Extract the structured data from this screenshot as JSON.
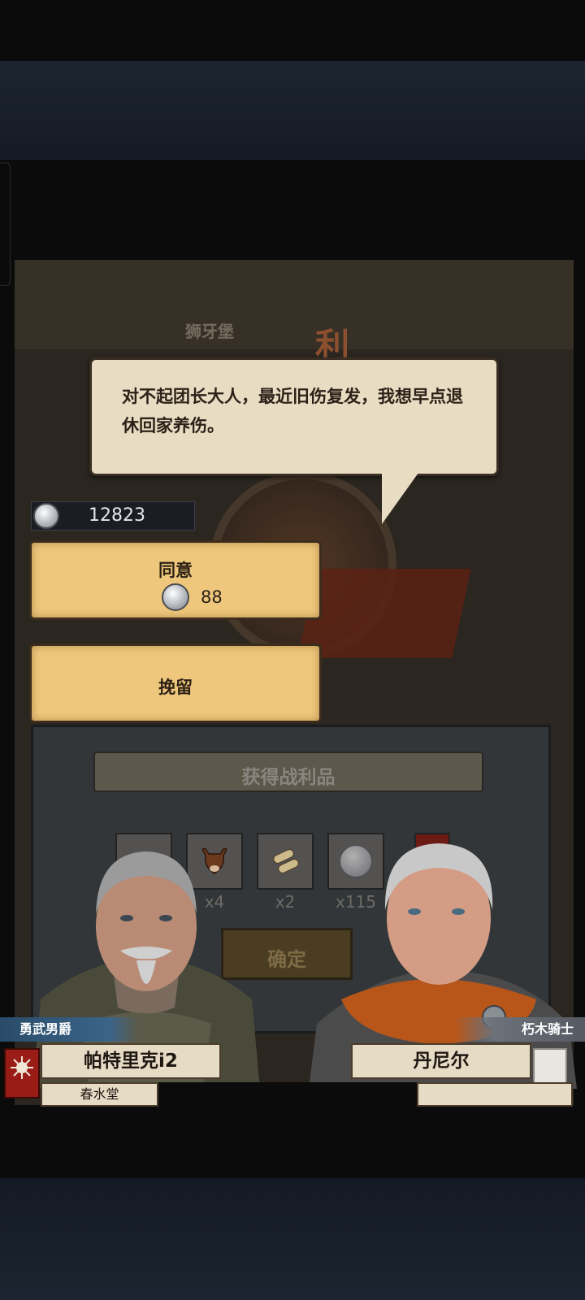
{
  "dialogue": {
    "text": "对不起团长大人，最近旧伤复发，我想早点退休回家养伤。"
  },
  "currency": {
    "silver_amount": "12823",
    "icon": "silver-coin-icon"
  },
  "choices": {
    "agree_label": "同意",
    "agree_cost": "88",
    "retain_label": "挽留"
  },
  "background": {
    "location_label": "狮牙堡",
    "banner_char": "利"
  },
  "loot": {
    "title": "获得战利品",
    "items": [
      {
        "icon": "cattle-icon",
        "qty": "x4"
      },
      {
        "icon": "scroll-icon",
        "qty": "x2"
      },
      {
        "icon": "silver-coin-icon",
        "qty": "x115"
      }
    ],
    "confirm_label": "确定"
  },
  "left_character": {
    "title": "勇武男爵",
    "name": "帕特里克i2",
    "house": "春水堂"
  },
  "right_character": {
    "title": "朽木骑士",
    "name": "丹尼尔"
  },
  "colors": {
    "parchment": "#e8dcc2",
    "choice_button": "#eec77c",
    "left_title_badge": "#3b6488",
    "right_title_badge": "#6c717a",
    "house_crest": "#9a1c16"
  }
}
